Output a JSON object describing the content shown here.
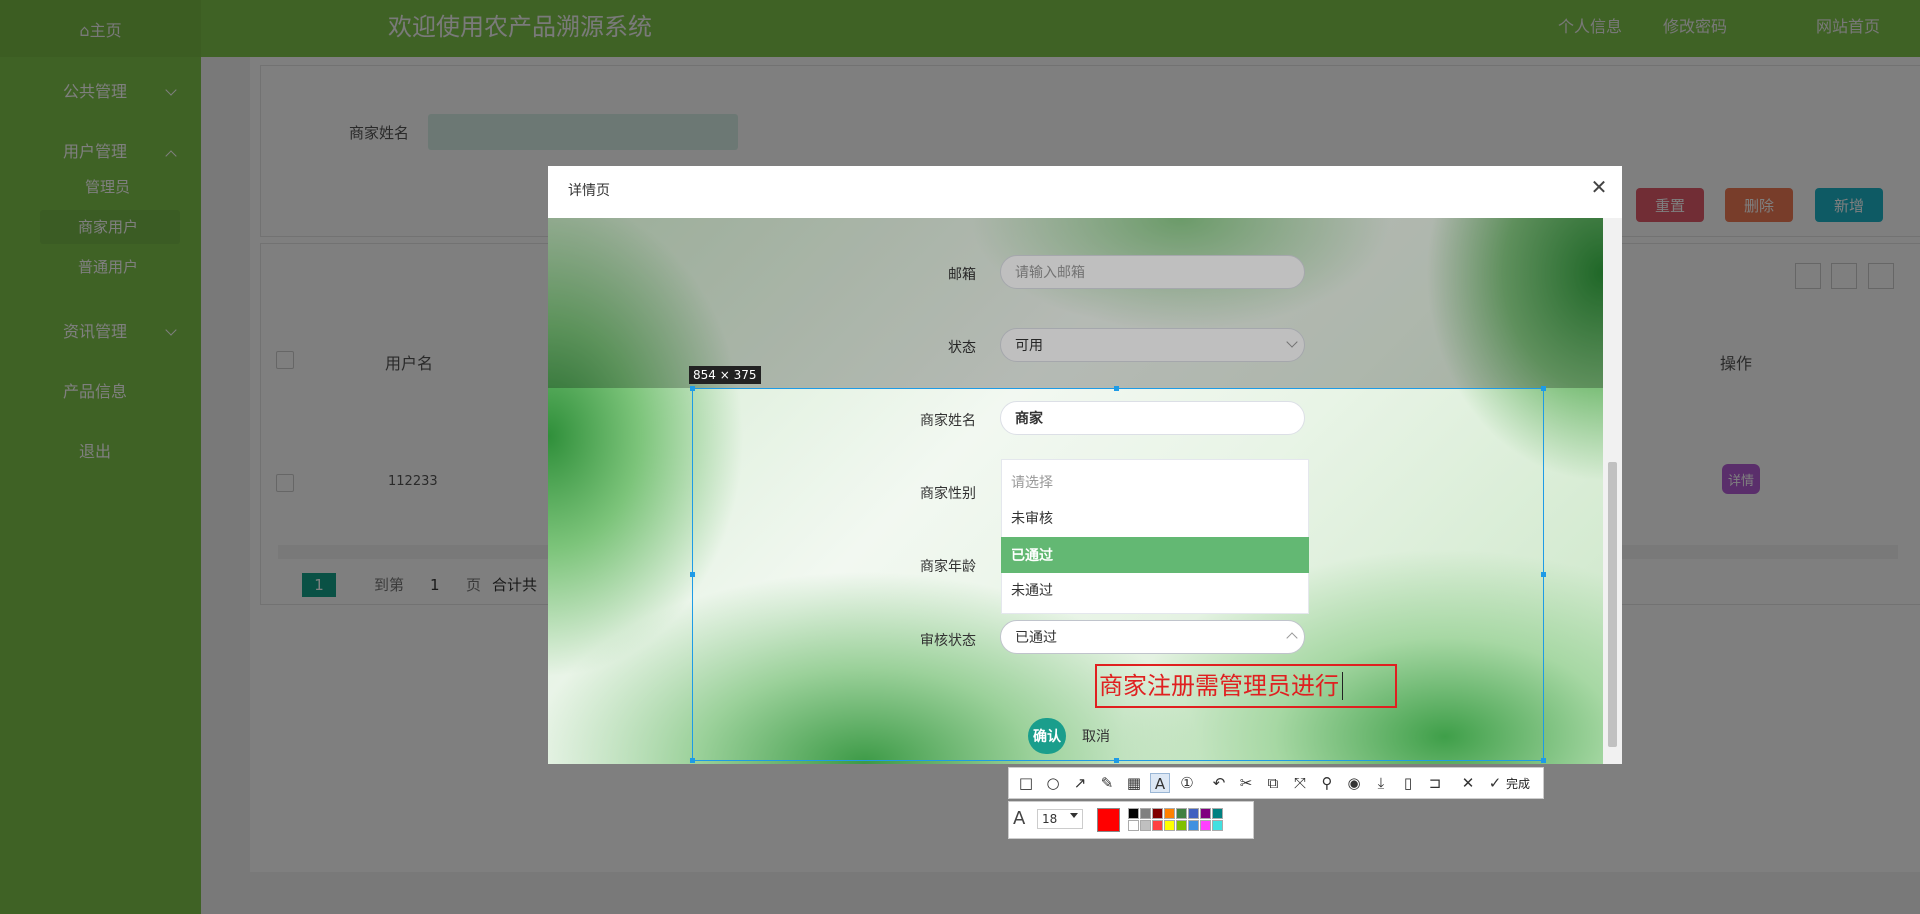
{
  "topbar": {
    "home": "⌂主页",
    "title": "欢迎使用农产品溯源系统",
    "links": [
      "个人信息",
      "修改密码",
      "网站首页"
    ]
  },
  "sidebar": {
    "public": "公共管理",
    "users": "用户管理",
    "sub": [
      "管理员",
      "商家用户",
      "普通用户"
    ],
    "news": "资讯管理",
    "products": "产品信息",
    "logout": "退出"
  },
  "search": {
    "label": "商家姓名"
  },
  "buttons": {
    "reset": "重置",
    "delete": "删除",
    "add": "新增"
  },
  "table": {
    "headers": {
      "username": "用户名",
      "actions": "操作"
    },
    "row": {
      "username": "112233",
      "detail": "详情"
    }
  },
  "pager": {
    "current": "1",
    "goto": "到第",
    "page_input": "1",
    "page": "页",
    "total": "合计共"
  },
  "modal": {
    "title": "详情页",
    "close": "✕",
    "email_label": "邮箱",
    "email_placeholder": "请输入邮箱",
    "status_label": "状态",
    "status_value": "可用",
    "merchant_name_label": "商家姓名",
    "merchant_name_value": "商家",
    "gender_label": "商家性别",
    "age_label": "商家年龄",
    "audit_label": "审核状态",
    "audit_value": "已通过",
    "confirm": "确认",
    "cancel": "取消"
  },
  "dropdown": {
    "placeholder": "请选择",
    "options": [
      "未审核",
      "已通过",
      "未通过"
    ],
    "selected": "已通过"
  },
  "capture": {
    "size": "854 × 375",
    "annotation": "商家注册需管理员进行"
  },
  "toolbar": {
    "finish": "完成",
    "font_size": "18",
    "current_color": "#ff0000",
    "colors_top": [
      "#000000",
      "#808080",
      "#800000",
      "#ff8000",
      "#408040",
      "#4060c0",
      "#800080",
      "#008080"
    ],
    "colors_bottom": [
      "#ffffff",
      "#c0c0c0",
      "#ff4040",
      "#ffff00",
      "#80c000",
      "#4090e0",
      "#ff40ff",
      "#40e0e0"
    ]
  }
}
